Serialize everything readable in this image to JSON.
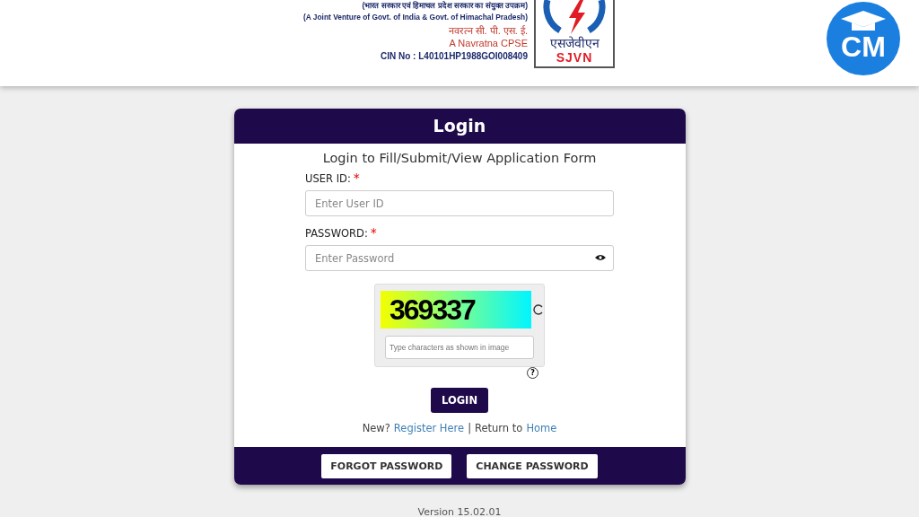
{
  "header": {
    "lines": [
      "(भारत सरकार एवं हिमाचल प्रदेश सरकार का संयुक्त उपक्रम)",
      "(A Joint Venture of Govt. of India & Govt. of Himachal Pradesh)",
      "नवरत्न सी. पी. एस. ई.",
      "A Navratna CPSE",
      "CIN No : L40101HP1988GOI008409"
    ],
    "logo_hindi": "एसजेवीएन",
    "logo_text": "SJVN",
    "badge": "CM"
  },
  "login": {
    "title": "Login",
    "subtitle": "Login to Fill/Submit/View Application Form",
    "fields": [
      {
        "label": "USER ID:",
        "required": "*",
        "placeholder": "Enter User ID",
        "kind": "text"
      },
      {
        "label": "PASSWORD:",
        "required": "*",
        "placeholder": "Enter Password",
        "kind": "password"
      }
    ],
    "captcha": {
      "code": "369337",
      "placeholder": "Type characters as shown in image",
      "help": "?"
    },
    "button": "LOGIN",
    "links": {
      "new": "New?",
      "register": "Register Here",
      "separator": "|",
      "return": "Return to",
      "home": "Home"
    },
    "footer_buttons": [
      "FORGOT PASSWORD",
      "CHANGE PASSWORD"
    ]
  },
  "version": "Version 15.02.01"
}
